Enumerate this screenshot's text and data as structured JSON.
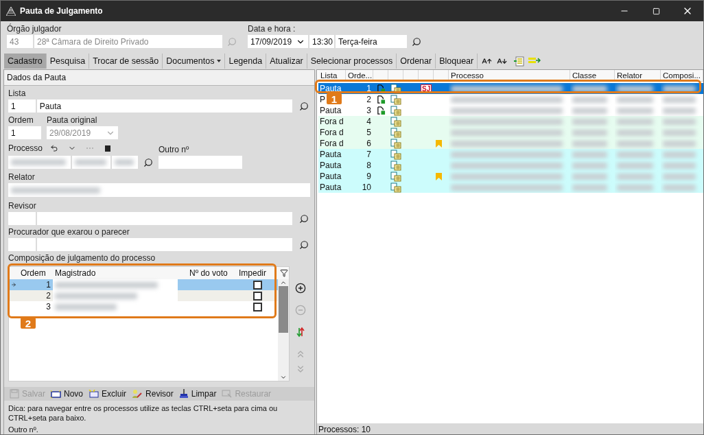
{
  "window": {
    "title": "Pauta de Julgamento"
  },
  "header": {
    "orgao_label": "Órgão julgador",
    "orgao_code": "43",
    "orgao_name": "28ª Câmara de Direito Privado",
    "datetime_label": "Data e hora :",
    "date": "17/09/2019",
    "time": "13:30",
    "weekday": "Terça-feira"
  },
  "toolbar": [
    {
      "label": "Cadastro",
      "kind": "button",
      "selected": true
    },
    {
      "label": "Pesquisa",
      "kind": "button",
      "selected": false
    },
    {
      "label": "Trocar de sessão",
      "kind": "button",
      "selected": false
    },
    {
      "label": "Documentos",
      "kind": "dropdown",
      "selected": false
    },
    {
      "label": "Legenda",
      "kind": "button",
      "selected": false
    },
    {
      "label": "Atualizar",
      "kind": "button",
      "selected": false
    },
    {
      "label": "Selecionar processos",
      "kind": "button",
      "selected": false
    },
    {
      "label": "Ordenar",
      "kind": "button",
      "selected": false
    },
    {
      "label": "Bloquear",
      "kind": "button",
      "selected": false
    }
  ],
  "form": {
    "title": "Dados da Pauta",
    "lista_label": "Lista",
    "lista_code": "1",
    "lista_name": "Pauta",
    "ordem_label": "Ordem",
    "ordem": "1",
    "pauta_original_label": "Pauta original",
    "pauta_original": "29/08/2019",
    "processo_label": "Processo",
    "outro_label": "Outro nº",
    "relator_label": "Relator",
    "revisor_label": "Revisor",
    "procurador_label": "Procurador que exarou o parecer",
    "composicao_label": "Composição de julgamento do processo"
  },
  "composition": {
    "columns": [
      "Ordem",
      "Magistrado",
      "Nº do voto",
      "Impedir"
    ],
    "rows": [
      {
        "ordem": "1",
        "selected": true,
        "impedir": false
      },
      {
        "ordem": "2",
        "selected": false,
        "impedir": false
      },
      {
        "ordem": "3",
        "selected": false,
        "impedir": false
      }
    ]
  },
  "actions": [
    {
      "label": "Salvar",
      "kind": "save",
      "disabled": true
    },
    {
      "label": "Novo",
      "kind": "new",
      "disabled": false
    },
    {
      "label": "Excluir",
      "kind": "delete",
      "disabled": false
    },
    {
      "label": "Revisor",
      "kind": "reviewer",
      "disabled": false
    },
    {
      "label": "Limpar",
      "kind": "clear",
      "disabled": false
    },
    {
      "label": "Restaurar",
      "kind": "restore",
      "disabled": true
    }
  ],
  "tip": "Dica: para navegar entre os processos utilize as teclas CTRL+seta para cima ou CTRL+seta para baixo.",
  "footer_label": "Outro nº.",
  "processes": {
    "columns_left": [
      "Lista",
      "Orde..."
    ],
    "columns_right": [
      "Processo",
      "Classe",
      "Relator",
      "Composi..."
    ],
    "rows": [
      {
        "lista": "Pauta",
        "ordem": "1",
        "selected": true,
        "document": true,
        "tag": "SJ",
        "bookmarked": false
      },
      {
        "lista": "P",
        "ordem": "2",
        "selected": false,
        "color": "#ffffff",
        "document": true,
        "bookmarked": false
      },
      {
        "lista": "Pauta",
        "ordem": "3",
        "selected": false,
        "color": "#ffffff",
        "document": true,
        "bookmarked": false
      },
      {
        "lista": "Fora d",
        "ordem": "4",
        "selected": false,
        "color": "#e6fcf0",
        "document": false,
        "bookmarked": false
      },
      {
        "lista": "Fora d",
        "ordem": "5",
        "selected": false,
        "color": "#e6fcf0",
        "document": false,
        "bookmarked": false
      },
      {
        "lista": "Fora d",
        "ordem": "6",
        "selected": false,
        "color": "#e6fcf0",
        "document": false,
        "bookmarked": true
      },
      {
        "lista": "Pauta",
        "ordem": "7",
        "selected": false,
        "color": "#ccfcfc",
        "document": false,
        "bookmarked": false
      },
      {
        "lista": "Pauta",
        "ordem": "8",
        "selected": false,
        "color": "#ccfcfc",
        "document": false,
        "bookmarked": false
      },
      {
        "lista": "Pauta",
        "ordem": "9",
        "selected": false,
        "color": "#ccfcfc",
        "document": false,
        "bookmarked": true
      },
      {
        "lista": "Pauta",
        "ordem": "10",
        "selected": false,
        "color": "#ccfcfc",
        "document": false,
        "bookmarked": false
      }
    ],
    "status": "Processos: 10"
  },
  "annotations": [
    {
      "label": "1"
    },
    {
      "label": "2"
    }
  ]
}
